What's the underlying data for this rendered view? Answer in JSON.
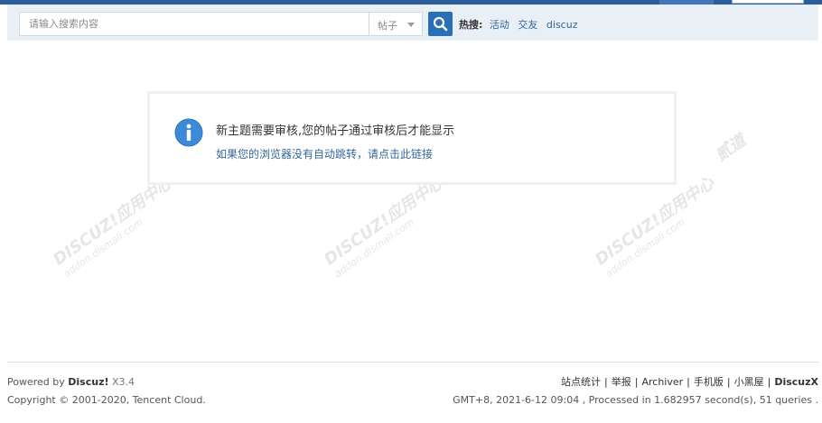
{
  "header": {
    "search_placeholder": "请输入搜索内容",
    "search_type": "帖子",
    "hot_label": "热搜:",
    "hot_keywords": [
      "活动",
      "交友",
      "discuz"
    ]
  },
  "message": {
    "text": "新主题需要审核,您的帖子通过审核后才能显示",
    "redirect_link": "如果您的浏览器没有自动跳转，请点击此链接"
  },
  "watermark": {
    "brand": "DISCUZ!应用中心",
    "tag": "贰道",
    "url": "addon.dismall.com"
  },
  "footer": {
    "powered_prefix": "Powered by",
    "powered_brand": "Discuz!",
    "version": "X3.4",
    "copyright": "Copyright © 2001-2020, Tencent Cloud.",
    "links": [
      "站点统计",
      "举报",
      "Archiver",
      "手机版",
      "小黑屋"
    ],
    "brand_right": "DiscuzX",
    "stats": "GMT+8, 2021-6-12 09:04 , Processed in 1.682957 second(s), 51 queries ."
  },
  "colors": {
    "accent": "#2a6fb5",
    "link": "#336699",
    "search_strip": "#e8eff5"
  }
}
